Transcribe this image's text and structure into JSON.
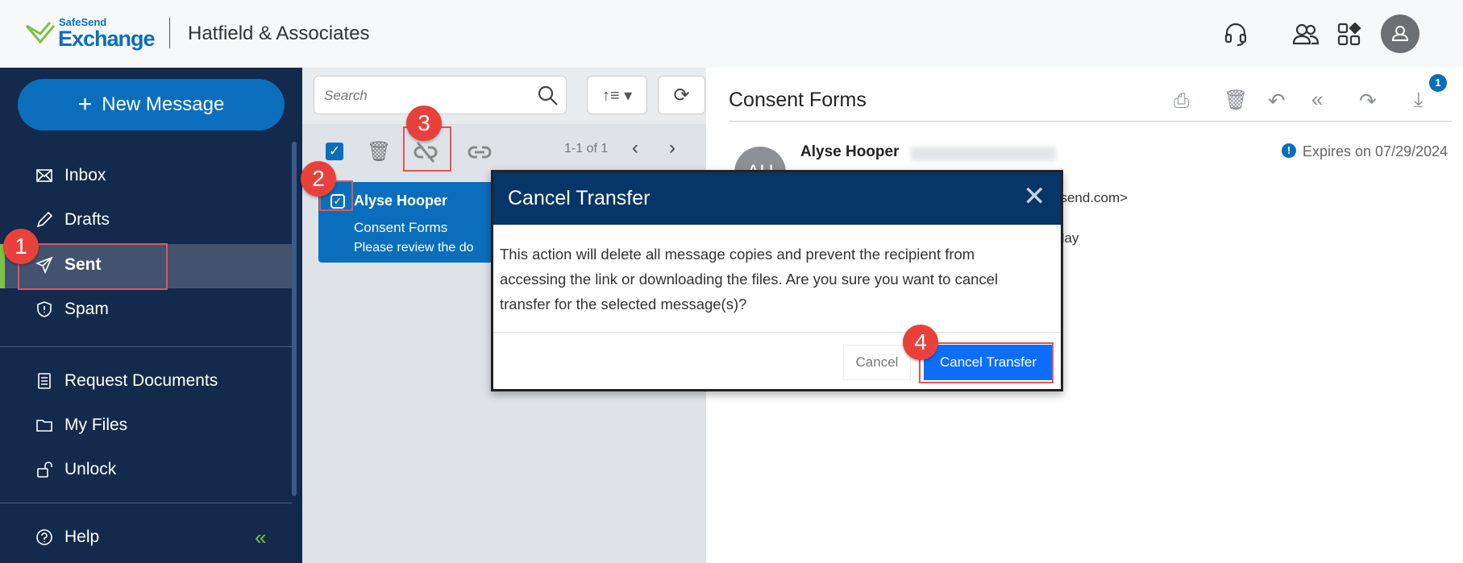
{
  "header": {
    "logo_top": "SafeSend",
    "logo_bottom": "Exchange",
    "company": "Hatfield & Associates",
    "icons": [
      "headset-icon",
      "users-icon",
      "apps-icon",
      "user-avatar-icon"
    ]
  },
  "sidebar": {
    "new_message": "New Message",
    "items": [
      {
        "label": "Inbox",
        "icon": "envelope-icon"
      },
      {
        "label": "Drafts",
        "icon": "pencil-icon"
      },
      {
        "label": "Sent",
        "icon": "paper-plane-icon",
        "active": true
      },
      {
        "label": "Spam",
        "icon": "shield-icon"
      },
      {
        "label": "Request Documents",
        "icon": "document-icon"
      },
      {
        "label": "My Files",
        "icon": "folder-icon"
      },
      {
        "label": "Unlock",
        "icon": "unlock-icon"
      }
    ],
    "help": "Help"
  },
  "list": {
    "search_placeholder": "Search",
    "pagination": "1-1 of 1",
    "message": {
      "sender": "Alyse Hooper",
      "subject": "Consent Forms",
      "preview": "Please review the do"
    }
  },
  "reader": {
    "title": "Consent Forms",
    "download_count": "1",
    "avatar_initials": "AH",
    "sender": "Alyse Hooper",
    "expires": "Expires on 07/29/2024",
    "to_fragment": "esend.com>",
    "body_fragment": "day"
  },
  "dialog": {
    "title": "Cancel Transfer",
    "body": "This action will delete all message copies and prevent the recipient from accessing the link or downloading the files. Are you sure you want to cancel transfer for the selected message(s)?",
    "cancel": "Cancel",
    "confirm": "Cancel Transfer"
  },
  "annotations": [
    "1",
    "2",
    "3",
    "4"
  ],
  "colors": {
    "accent": "#0a6ebd",
    "sidebar": "#132a4c",
    "dialog_header": "#063667",
    "confirm": "#0d6efd",
    "annotation": "#e8413c"
  }
}
